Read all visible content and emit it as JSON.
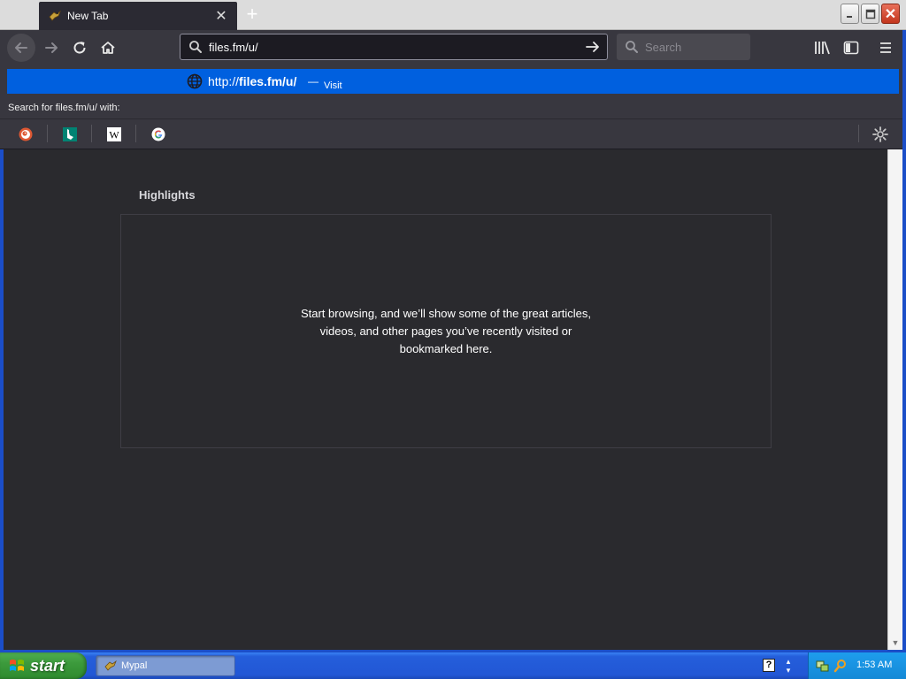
{
  "browser": {
    "tab": {
      "title": "New Tab"
    },
    "url": {
      "value": "files.fm/u/"
    },
    "search": {
      "placeholder": "Search"
    },
    "suggestion": {
      "url_prefix": "http://",
      "url_bold": "files.fm/u/",
      "separator": "—",
      "action": "Visit"
    },
    "search_with": "Search for files.fm/u/ with:",
    "engines": [
      {
        "name": "duckduckgo",
        "color": "#de5833"
      },
      {
        "name": "bing",
        "color": "#008373"
      },
      {
        "name": "wikipedia",
        "color": "#ffffff"
      },
      {
        "name": "google",
        "color": "#4285f4"
      }
    ]
  },
  "content": {
    "highlights_title": "Highlights",
    "empty_message": "Start browsing, and we’ll show some of the great articles, videos, and other pages you’ve recently visited or bookmarked here."
  },
  "taskbar": {
    "start_label": "start",
    "task_label": "Mypal",
    "clock": "1:53 AM"
  },
  "colors": {
    "accent": "#0060df",
    "content_bg": "#2a2a2e",
    "toolbar_bg": "#38373f"
  }
}
